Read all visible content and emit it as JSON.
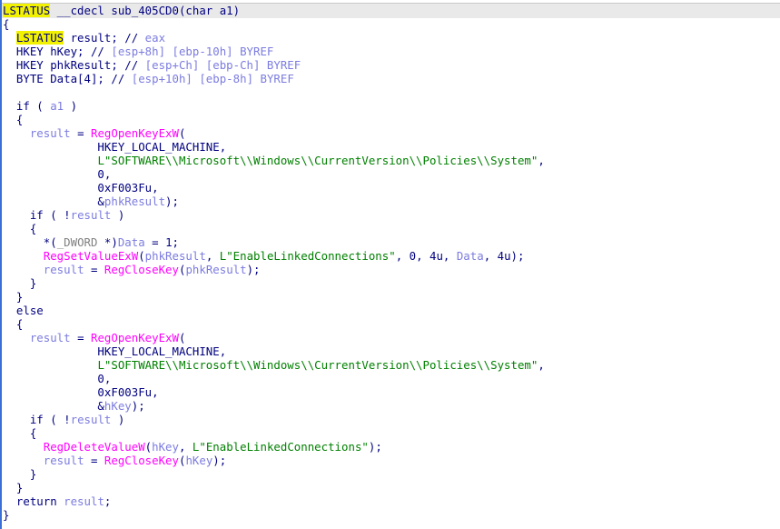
{
  "title": "sub_405CD0 pseudocode",
  "lines": [
    [
      [
        "h",
        "LSTATUS"
      ],
      [
        "p",
        " __cdecl sub_405CD0(char a1)"
      ]
    ],
    [
      [
        "p",
        "{"
      ]
    ],
    [
      [
        "p",
        "  "
      ],
      [
        "h",
        "LSTATUS"
      ],
      [
        "p",
        " result; // "
      ],
      [
        "c",
        "eax"
      ]
    ],
    [
      [
        "p",
        "  HKEY hKey; // "
      ],
      [
        "c",
        "[esp+8h] [ebp-10h] BYREF"
      ]
    ],
    [
      [
        "p",
        "  HKEY phkResult; // "
      ],
      [
        "c",
        "[esp+Ch] [ebp-Ch] BYREF"
      ]
    ],
    [
      [
        "p",
        "  BYTE Data[4]; // "
      ],
      [
        "c",
        "[esp+10h] [ebp-8h] BYREF"
      ]
    ],
    [],
    [
      [
        "p",
        "  if ( "
      ],
      [
        "v",
        "a1"
      ],
      [
        "p",
        " )"
      ]
    ],
    [
      [
        "p",
        "  {"
      ]
    ],
    [
      [
        "p",
        "    "
      ],
      [
        "v",
        "result"
      ],
      [
        "p",
        " = "
      ],
      [
        "f",
        "RegOpenKeyExW"
      ],
      [
        "p",
        "("
      ]
    ],
    [
      [
        "p",
        "              HKEY_LOCAL_MACHINE,"
      ]
    ],
    [
      [
        "p",
        "              "
      ],
      [
        "s",
        "L\"SOFTWARE\\\\Microsoft\\\\Windows\\\\CurrentVersion\\\\Policies\\\\System\""
      ],
      [
        "p",
        ","
      ]
    ],
    [
      [
        "n",
        "              0"
      ],
      [
        "p",
        ","
      ]
    ],
    [
      [
        "n",
        "              0xF003Fu"
      ],
      [
        "p",
        ","
      ]
    ],
    [
      [
        "p",
        "              &"
      ],
      [
        "v",
        "phkResult"
      ],
      [
        "p",
        ");"
      ]
    ],
    [
      [
        "p",
        "    if ( !"
      ],
      [
        "v",
        "result"
      ],
      [
        "p",
        " )"
      ]
    ],
    [
      [
        "p",
        "    {"
      ]
    ],
    [
      [
        "p",
        "      *("
      ],
      [
        "g",
        "_DWORD"
      ],
      [
        "p",
        " *)"
      ],
      [
        "v",
        "Data"
      ],
      [
        "p",
        " = 1;"
      ]
    ],
    [
      [
        "p",
        "      "
      ],
      [
        "f",
        "RegSetValueExW"
      ],
      [
        "p",
        "("
      ],
      [
        "v",
        "phkResult"
      ],
      [
        "p",
        ", "
      ],
      [
        "s",
        "L\"EnableLinkedConnections\""
      ],
      [
        "p",
        ", 0, 4u, "
      ],
      [
        "v",
        "Data"
      ],
      [
        "p",
        ", 4u);"
      ]
    ],
    [
      [
        "p",
        "      "
      ],
      [
        "v",
        "result"
      ],
      [
        "p",
        " = "
      ],
      [
        "f",
        "RegCloseKey"
      ],
      [
        "p",
        "("
      ],
      [
        "v",
        "phkResult"
      ],
      [
        "p",
        ");"
      ]
    ],
    [
      [
        "p",
        "    }"
      ]
    ],
    [
      [
        "p",
        "  }"
      ]
    ],
    [
      [
        "p",
        "  else"
      ]
    ],
    [
      [
        "p",
        "  {"
      ]
    ],
    [
      [
        "p",
        "    "
      ],
      [
        "v",
        "result"
      ],
      [
        "p",
        " = "
      ],
      [
        "f",
        "RegOpenKeyExW"
      ],
      [
        "p",
        "("
      ]
    ],
    [
      [
        "p",
        "              HKEY_LOCAL_MACHINE,"
      ]
    ],
    [
      [
        "p",
        "              "
      ],
      [
        "s",
        "L\"SOFTWARE\\\\Microsoft\\\\Windows\\\\CurrentVersion\\\\Policies\\\\System\""
      ],
      [
        "p",
        ","
      ]
    ],
    [
      [
        "n",
        "              0"
      ],
      [
        "p",
        ","
      ]
    ],
    [
      [
        "n",
        "              0xF003Fu"
      ],
      [
        "p",
        ","
      ]
    ],
    [
      [
        "p",
        "              &"
      ],
      [
        "v",
        "hKey"
      ],
      [
        "p",
        ");"
      ]
    ],
    [
      [
        "p",
        "    if ( !"
      ],
      [
        "v",
        "result"
      ],
      [
        "p",
        " )"
      ]
    ],
    [
      [
        "p",
        "    {"
      ]
    ],
    [
      [
        "p",
        "      "
      ],
      [
        "f",
        "RegDeleteValueW"
      ],
      [
        "p",
        "("
      ],
      [
        "v",
        "hKey"
      ],
      [
        "p",
        ", "
      ],
      [
        "s",
        "L\"EnableLinkedConnections\""
      ],
      [
        "p",
        ");"
      ]
    ],
    [
      [
        "p",
        "      "
      ],
      [
        "v",
        "result"
      ],
      [
        "p",
        " = "
      ],
      [
        "f",
        "RegCloseKey"
      ],
      [
        "p",
        "("
      ],
      [
        "v",
        "hKey"
      ],
      [
        "p",
        ");"
      ]
    ],
    [
      [
        "p",
        "    }"
      ]
    ],
    [
      [
        "p",
        "  }"
      ]
    ],
    [
      [
        "p",
        "  return "
      ],
      [
        "v",
        "result"
      ],
      [
        "p",
        ";"
      ]
    ],
    [
      [
        "p",
        "}"
      ]
    ]
  ]
}
